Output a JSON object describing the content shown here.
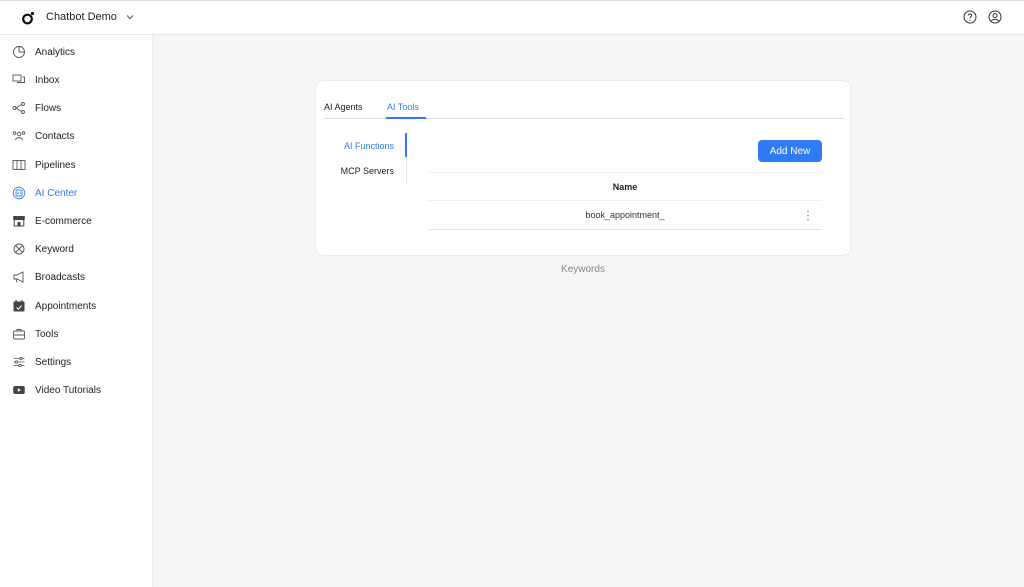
{
  "header": {
    "workspace_name": "Chatbot Demo",
    "logo_icon": "logo-icon",
    "right_icons": [
      "help-icon",
      "account-icon"
    ]
  },
  "sidebar": {
    "active_color": "#2f7bf5",
    "items": [
      {
        "label": "Analytics",
        "icon": "analytics-icon"
      },
      {
        "label": "Inbox",
        "icon": "inbox-icon"
      },
      {
        "label": "Flows",
        "icon": "flows-icon"
      },
      {
        "label": "Contacts",
        "icon": "contacts-icon"
      },
      {
        "label": "Pipelines",
        "icon": "pipelines-icon"
      },
      {
        "label": "AI Center",
        "icon": "ai-center-icon",
        "active": true
      },
      {
        "label": "E-commerce",
        "icon": "store-icon"
      },
      {
        "label": "Keyword",
        "icon": "keyword-icon"
      },
      {
        "label": "Broadcasts",
        "icon": "megaphone-icon"
      },
      {
        "label": "Appointments",
        "icon": "calendar-icon"
      },
      {
        "label": "Tools",
        "icon": "toolbox-icon"
      },
      {
        "label": "Settings",
        "icon": "sliders-icon"
      },
      {
        "label": "Video Tutorials",
        "icon": "youtube-icon"
      }
    ]
  },
  "main": {
    "tabs": [
      {
        "label": "AI Agents",
        "active": false
      },
      {
        "label": "AI Tools",
        "active": true
      }
    ],
    "subtabs": [
      {
        "label": "AI Functions",
        "active": true
      },
      {
        "label": "MCP Servers",
        "active": false
      }
    ],
    "add_button_label": "Add New",
    "table": {
      "columns": [
        "Name"
      ],
      "rows": [
        {
          "name": "book_appointment_"
        }
      ]
    },
    "footer_label": "Keywords"
  }
}
